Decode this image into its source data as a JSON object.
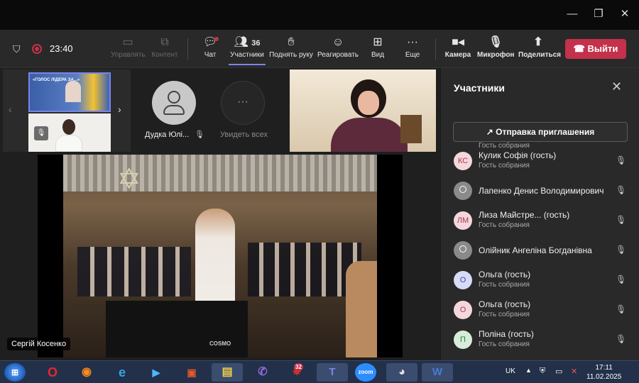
{
  "toolbar": {
    "timer": "23:40",
    "buttons": [
      {
        "label": "Управлять",
        "icon": "share-screen-icon"
      },
      {
        "label": "Контент",
        "icon": "content-icon"
      },
      {
        "label": "Чат",
        "icon": "chat-icon"
      },
      {
        "label": "Участники",
        "icon": "people-icon",
        "count": "36"
      },
      {
        "label": "Поднять руку",
        "icon": "hand-icon"
      },
      {
        "label": "Реагировать",
        "icon": "smile-icon"
      },
      {
        "label": "Вид",
        "icon": "view-icon"
      },
      {
        "label": "Еще",
        "icon": "more-icon"
      },
      {
        "label": "Камера",
        "icon": "camera-icon"
      },
      {
        "label": "Микрофон",
        "icon": "mic-off-icon"
      },
      {
        "label": "Поделиться",
        "icon": "share-icon"
      }
    ],
    "leave_label": "Выйти"
  },
  "stage": {
    "tile_name_1": "Дудка Юлі...",
    "tile_name_2": "Увидеть всех",
    "thumb_text": "«ГОЛОС ЛІДЕРА ЗА...»",
    "speaker_name": "Сергій Косенко"
  },
  "panel": {
    "title": "Участники",
    "invite_label": "Отправка приглашения",
    "top_role": "Гость собрания",
    "participants": [
      {
        "initials": "КС",
        "name": "Кулик Софія (гость)",
        "role": "Гость собрания",
        "color": "#f4d7dd",
        "text": "#b1364d"
      },
      {
        "initials": "",
        "name": "Лапенко Денис Володимирович",
        "role": "",
        "color": "#8a8a8a",
        "text": "#fff"
      },
      {
        "initials": "ЛМ",
        "name": "Лиза Майстре...   (гость)",
        "role": "Гость собрания",
        "color": "#f4d7dd",
        "text": "#b1364d"
      },
      {
        "initials": "",
        "name": "Олійник Ангеліна Богданівна",
        "role": "",
        "color": "#8a8a8a",
        "text": "#fff"
      },
      {
        "initials": "О",
        "name": "Ольга (гость)",
        "role": "Гость собрания",
        "color": "#d7dbf6",
        "text": "#3b4ab3"
      },
      {
        "initials": "О",
        "name": "Ольга (гость)",
        "role": "Гость собрания",
        "color": "#f4d7dd",
        "text": "#b1364d"
      },
      {
        "initials": "П",
        "name": "Поліна (гость)",
        "role": "Гость собрания",
        "color": "#d7ecd9",
        "text": "#2e7d3a"
      }
    ]
  },
  "taskbar": {
    "lang": "UK",
    "time": "17:11",
    "date": "11.02.2025",
    "badge": "32",
    "apps": [
      "start",
      "opera",
      "firefox",
      "ie",
      "media",
      "paint",
      "explorer",
      "viber",
      "game",
      "teams",
      "zoom",
      "chrome",
      "word"
    ]
  },
  "colors": {
    "accent": "#7b83eb",
    "leave": "#c4314b",
    "taskbar": "#223049"
  }
}
